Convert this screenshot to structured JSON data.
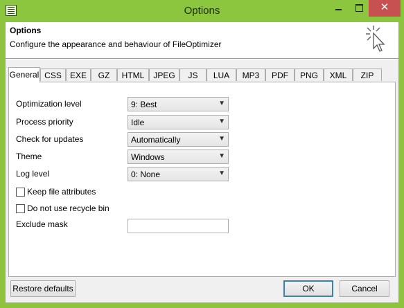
{
  "window": {
    "title": "Options",
    "close_glyph": "✕"
  },
  "header": {
    "title": "Options",
    "description": "Configure the appearance and behaviour of FileOptimizer"
  },
  "tabs": [
    {
      "label": "General",
      "active": true
    },
    {
      "label": "CSS"
    },
    {
      "label": "EXE"
    },
    {
      "label": "GZ"
    },
    {
      "label": "HTML"
    },
    {
      "label": "JPEG"
    },
    {
      "label": "JS"
    },
    {
      "label": "LUA"
    },
    {
      "label": "MP3"
    },
    {
      "label": "PDF"
    },
    {
      "label": "PNG"
    },
    {
      "label": "XML"
    },
    {
      "label": "ZIP"
    }
  ],
  "general": {
    "optimization_level": {
      "label": "Optimization level",
      "value": "9: Best"
    },
    "process_priority": {
      "label": "Process priority",
      "value": "Idle"
    },
    "check_updates": {
      "label": "Check for updates",
      "value": "Automatically"
    },
    "theme": {
      "label": "Theme",
      "value": "Windows"
    },
    "log_level": {
      "label": "Log level",
      "value": "0: None"
    },
    "keep_attributes": {
      "label": "Keep file attributes",
      "checked": false
    },
    "no_recycle_bin": {
      "label": "Do not use recycle bin",
      "checked": false
    },
    "exclude_mask": {
      "label": "Exclude mask",
      "value": ""
    }
  },
  "buttons": {
    "restore": "Restore defaults",
    "ok": "OK",
    "cancel": "Cancel"
  },
  "icons": {
    "app": "app-icon",
    "header": "cursor-click-icon",
    "dropdown": "chevron-down-icon"
  },
  "colors": {
    "titlebar": "#8cc63f",
    "close": "#c75050",
    "ok_border": "#3c7fb1"
  }
}
